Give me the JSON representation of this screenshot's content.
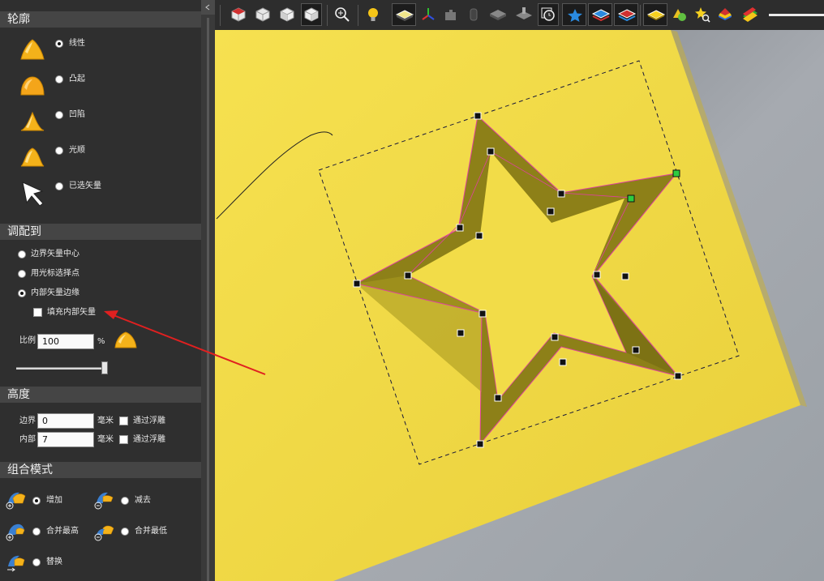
{
  "profile": {
    "title": "轮廓",
    "options": [
      {
        "label": "线性",
        "icon": "linear-profile-icon",
        "selected": true
      },
      {
        "label": "凸起",
        "icon": "convex-profile-icon",
        "selected": false
      },
      {
        "label": "凹陷",
        "icon": "concave-profile-icon",
        "selected": false
      },
      {
        "label": "光顺",
        "icon": "smooth-profile-icon",
        "selected": false
      },
      {
        "label": "已选矢量",
        "icon": "selected-vector-icon",
        "selected": false
      }
    ]
  },
  "fit": {
    "title": "调配到",
    "options": [
      {
        "label": "边界矢量中心",
        "selected": false
      },
      {
        "label": "用光标选择点",
        "selected": false
      },
      {
        "label": "内部矢量边缘",
        "selected": true
      }
    ],
    "fill_inner": {
      "label": "填充内部矢量",
      "checked": false
    },
    "scale_label": "比例",
    "scale_value": "100",
    "scale_unit": "%",
    "slider_level": 1.0
  },
  "height": {
    "title": "高度",
    "rows": [
      {
        "label": "边界",
        "value": "0",
        "unit": "毫米",
        "check_label": "通过浮雕",
        "checked": false
      },
      {
        "label": "内部",
        "value": "7",
        "unit": "毫米",
        "check_label": "通过浮雕",
        "checked": false
      }
    ]
  },
  "combine": {
    "title": "组合模式",
    "options": [
      {
        "label": "增加",
        "icon": "add-mode-icon",
        "selected": true
      },
      {
        "label": "减去",
        "icon": "subtract-mode-icon",
        "selected": false
      },
      {
        "label": "合并最高",
        "icon": "merge-highest-icon",
        "selected": false
      },
      {
        "label": "合并最低",
        "icon": "merge-lowest-icon",
        "selected": false
      },
      {
        "label": "替换",
        "icon": "replace-mode-icon",
        "selected": false
      }
    ]
  },
  "toolbar": {
    "icons": [
      "view-iso-icon",
      "view-top-icon",
      "view-front-icon",
      "view-side-icon",
      "zoom-icon",
      "light-bulb-icon",
      "shaded-view-icon",
      "axis-icon",
      "puzzle-icon",
      "cylinder-icon",
      "wireframe-icon",
      "machine-icon",
      "clock-icon",
      "star-relief-icon",
      "layer-icon",
      "layer-red-icon",
      "gold-plate-icon",
      "shapes-icon",
      "star-search-icon",
      "layers-colored-icon",
      "stack-icon"
    ]
  },
  "colors": {
    "relief": "#f2dc48",
    "star_bevel": "#8a7d14",
    "vector": "#e040a0",
    "handle_selected": "#2ecc40",
    "annotation": "#e02020"
  }
}
